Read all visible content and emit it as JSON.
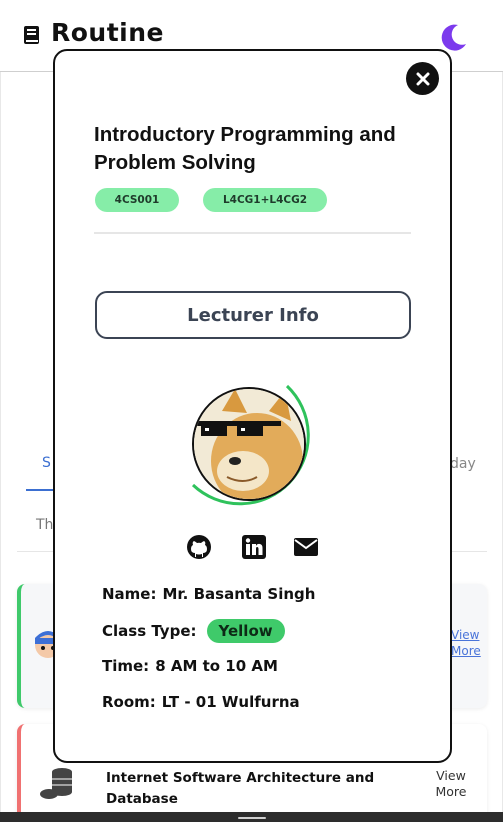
{
  "app": {
    "title": "Routine",
    "theme_icon": "moon-icon",
    "accent_color": "#7c3aed"
  },
  "background": {
    "tab_partial_left": "S",
    "tab_partial_right": "day",
    "day_partial": "Th",
    "card1": {
      "view_line1": "View",
      "view_line2": "More",
      "accent": "#3fc96b"
    },
    "card2": {
      "course": "Internet Software Architecture and Database",
      "view_line1": "View",
      "view_line2": "More",
      "accent": "#f07171"
    }
  },
  "modal": {
    "course_title": "Introductory Programming and Problem Solving",
    "module_code": "4CS001",
    "group": "L4CG1+L4CG2",
    "lecturer_button": "Lecturer Info",
    "socials": [
      "github-icon",
      "linkedin-icon",
      "mail-icon"
    ],
    "info": {
      "name_label": "Name:",
      "name_value": "Mr. Basanta Singh",
      "class_type_label": "Class Type:",
      "class_type_value": "Yellow",
      "time_label": "Time:",
      "time_value": "8 AM to 10 AM",
      "room_label": "Room:",
      "room_value": "LT - 01 Wulfurna"
    },
    "badge_color": "#86eda8",
    "type_color": "#3fca6a"
  }
}
